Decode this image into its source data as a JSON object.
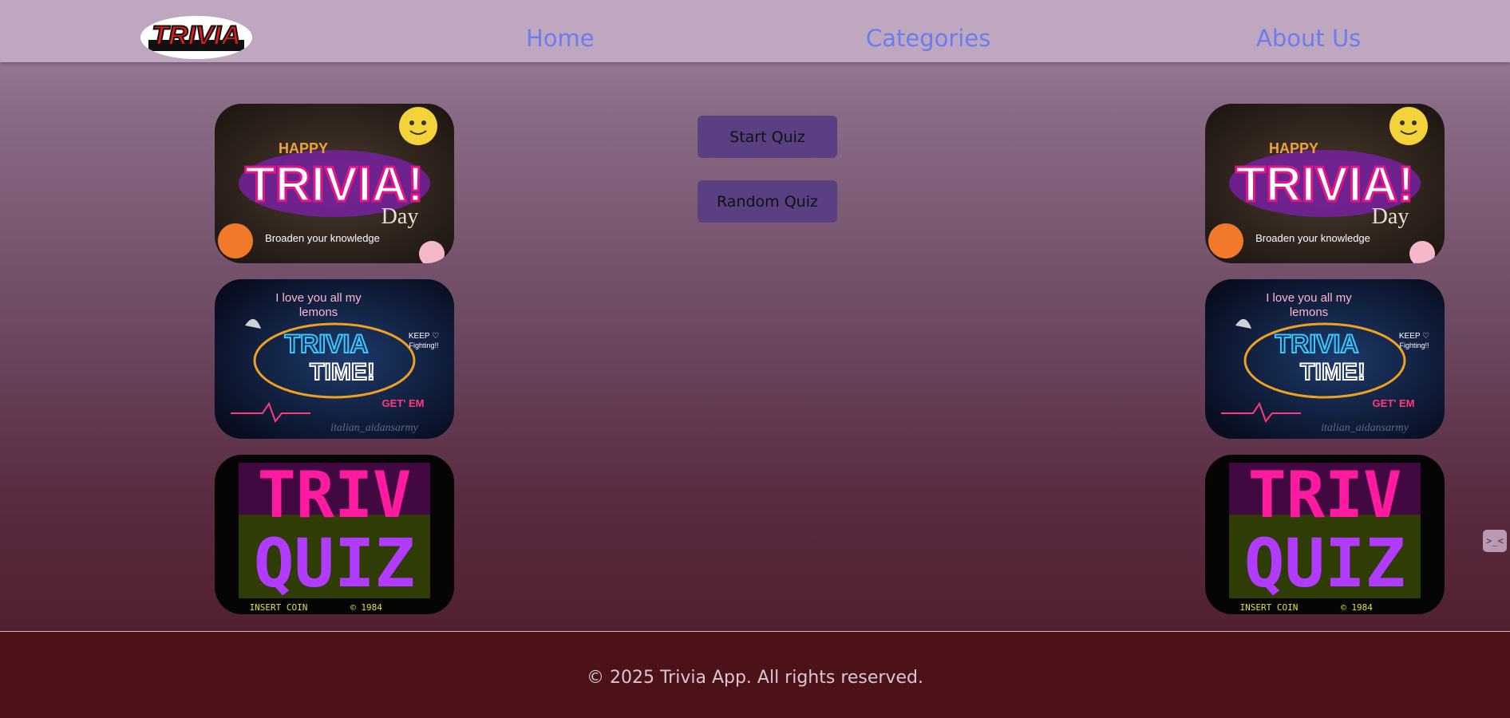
{
  "header": {
    "logo_text": "TRIVIA",
    "nav": {
      "home": "Home",
      "categories": "Categories",
      "about": "About Us"
    }
  },
  "images": {
    "happy_trivia": {
      "line1": "HAPPY",
      "line2": "TRIVIA!",
      "line3": "Day",
      "line4": "Broaden your knowledge"
    },
    "trivia_time": {
      "line1": "I love you all my",
      "line2": "lemons",
      "line3": "TRIVIA",
      "line4": "TIME!",
      "line5": "KEEP ♡",
      "line6": "Fighting!!",
      "line7": "GET' EM",
      "line8": "italian_aidansarmy"
    },
    "triv_quiz": {
      "line1": "TRIV",
      "line2": "QUIZ",
      "line3": "INSERT COIN",
      "line4": "© 1984"
    }
  },
  "buttons": {
    "start": "Start Quiz",
    "random": "Random Quiz"
  },
  "footer": {
    "text": "© 2025 Trivia App. All rights reserved."
  },
  "widget": {
    "label": ">_<"
  },
  "colors": {
    "header_bg": "#bfa8bf",
    "nav_link": "#6b7cf0",
    "button_bg": "#5a3f82",
    "footer_bg": "#4c1218"
  }
}
